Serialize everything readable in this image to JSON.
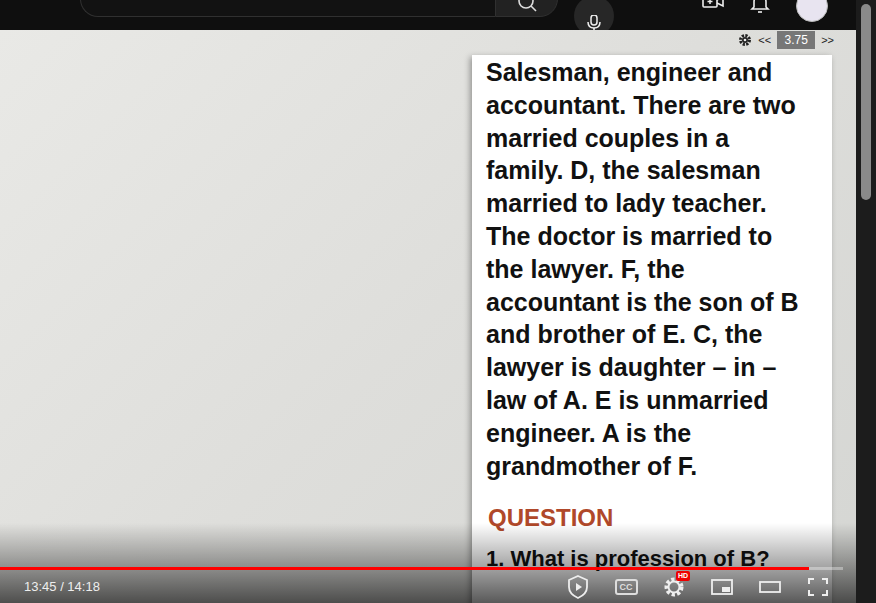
{
  "topbar": {
    "search": {
      "placeholder": "Search"
    }
  },
  "speed": {
    "decrease": "<<",
    "value": "3.75",
    "increase": ">>"
  },
  "slide": {
    "lines": [
      "Salesman, engineer and",
      "accountant. There are two",
      "married couples in a",
      "family. D, the salesman",
      "married to lady teacher.",
      "The doctor is married to",
      "the lawyer. F, the",
      "accountant is the son of B",
      "and brother of E. C, the",
      "lawyer is daughter – in –",
      "law of A. E is unmarried",
      "engineer. A is the",
      "grandmother of F."
    ],
    "question_heading": "QUESTION",
    "question": "1. What is profession of B?"
  },
  "player": {
    "time": "13:45 / 14:18",
    "progress": {
      "level": 0.96
    },
    "cc": "CC",
    "hd_badge": "HD"
  }
}
